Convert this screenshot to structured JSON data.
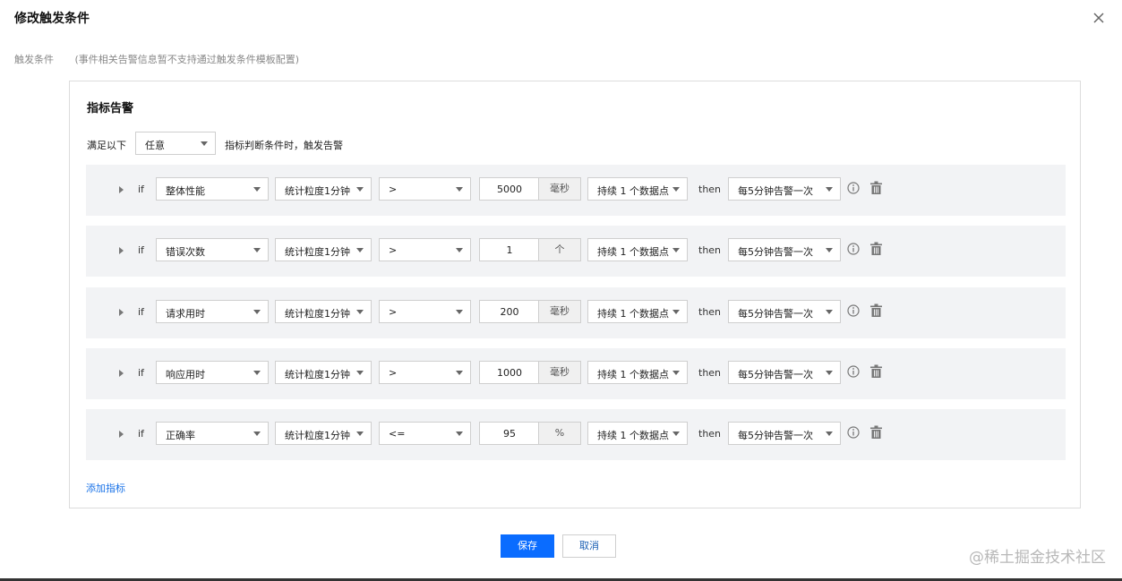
{
  "dialog": {
    "title": "修改触发条件",
    "field_label": "触发条件",
    "field_hint": "(事件相关告警信息暂不支持通过触发条件模板配置)"
  },
  "panel": {
    "title": "指标告警",
    "condition_prefix": "满足以下",
    "condition_select": "任意",
    "condition_suffix": "指标判断条件时，触发告警"
  },
  "rules": [
    {
      "if": "if",
      "metric": "整体性能",
      "granularity": "统计粒度1分钟",
      "operator": ">",
      "threshold": "5000",
      "unit": "毫秒",
      "duration": "持续 1 个数据点",
      "then": "then",
      "frequency": "每5分钟告警一次"
    },
    {
      "if": "if",
      "metric": "错误次数",
      "granularity": "统计粒度1分钟",
      "operator": ">",
      "threshold": "1",
      "unit": "个",
      "duration": "持续 1 个数据点",
      "then": "then",
      "frequency": "每5分钟告警一次"
    },
    {
      "if": "if",
      "metric": "请求用时",
      "granularity": "统计粒度1分钟",
      "operator": ">",
      "threshold": "200",
      "unit": "毫秒",
      "duration": "持续 1 个数据点",
      "then": "then",
      "frequency": "每5分钟告警一次"
    },
    {
      "if": "if",
      "metric": "响应用时",
      "granularity": "统计粒度1分钟",
      "operator": ">",
      "threshold": "1000",
      "unit": "毫秒",
      "duration": "持续 1 个数据点",
      "then": "then",
      "frequency": "每5分钟告警一次"
    },
    {
      "if": "if",
      "metric": "正确率",
      "granularity": "统计粒度1分钟",
      "operator": "<=",
      "threshold": "95",
      "unit": "%",
      "duration": "持续 1 个数据点",
      "then": "then",
      "frequency": "每5分钟告警一次"
    }
  ],
  "add_metric_label": "添加指标",
  "buttons": {
    "save": "保存",
    "cancel": "取消"
  },
  "watermark": "@稀土掘金技术社区",
  "colors": {
    "primary": "#0a6cff",
    "link": "#1a73e8",
    "rule_bg": "#f2f3f5"
  },
  "icons": {
    "close": "close-icon",
    "info": "info-icon",
    "delete": "trash-icon",
    "expand": "caret-right-icon",
    "dropdown": "chevron-down-icon"
  }
}
